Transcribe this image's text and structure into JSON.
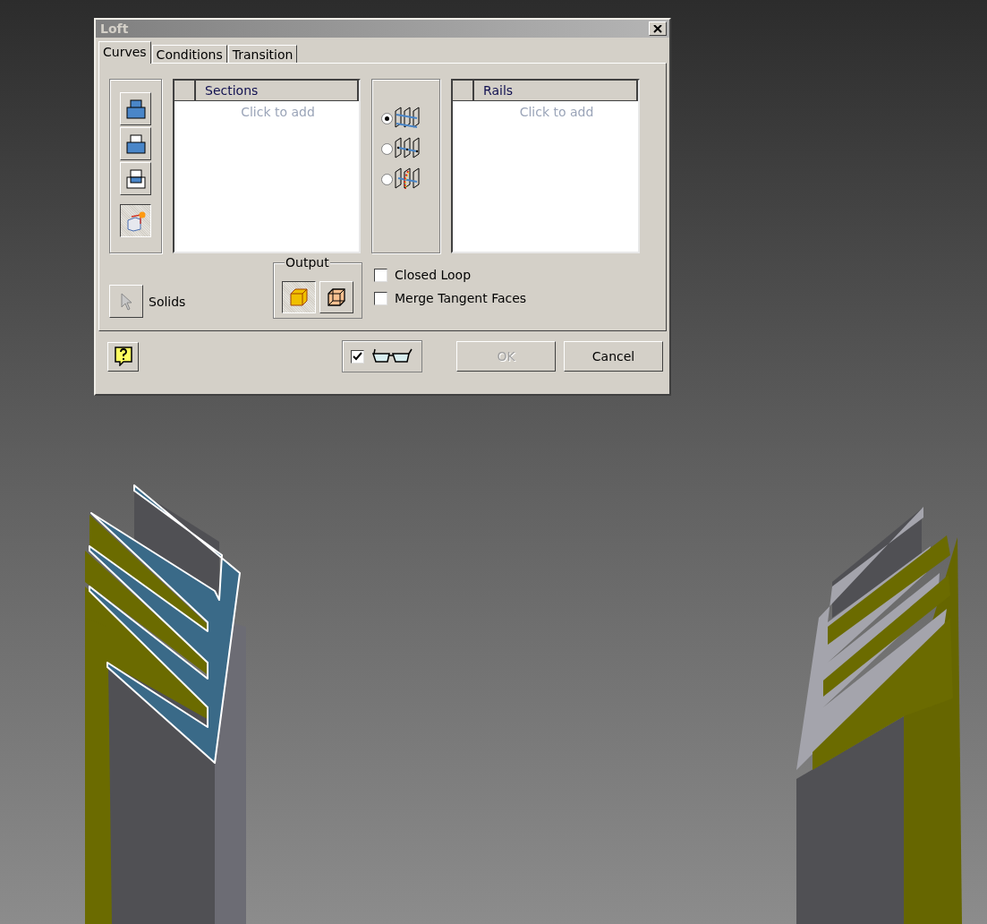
{
  "window": {
    "title": "Loft"
  },
  "tabs": [
    {
      "label": "Curves",
      "selected": true
    },
    {
      "label": "Conditions",
      "selected": false
    },
    {
      "label": "Transition",
      "selected": false
    }
  ],
  "section_tools": [
    {
      "kind": "add-top",
      "pressed": false
    },
    {
      "kind": "add-middle",
      "pressed": false
    },
    {
      "kind": "add-bottom",
      "pressed": false
    },
    {
      "kind": "new-sketch",
      "pressed": true
    }
  ],
  "sections": {
    "header": "Sections",
    "hint": "Click to add"
  },
  "rail_modes": [
    {
      "kind": "rails",
      "selected": true
    },
    {
      "kind": "centerline",
      "selected": false
    },
    {
      "kind": "area",
      "selected": false
    }
  ],
  "rails": {
    "header": "Rails",
    "hint": "Click to add"
  },
  "solids": {
    "label": "Solids"
  },
  "output": {
    "title": "Output",
    "options": [
      {
        "kind": "solid",
        "selected": true
      },
      {
        "kind": "surface",
        "selected": false
      }
    ]
  },
  "options": [
    {
      "label": "Closed Loop",
      "checked": false
    },
    {
      "label": "Merge Tangent Faces",
      "checked": false
    }
  ],
  "footer": {
    "preview": {
      "checked": true
    },
    "buttons": [
      {
        "label": "OK",
        "disabled": true
      },
      {
        "label": "Cancel",
        "disabled": false
      }
    ]
  }
}
